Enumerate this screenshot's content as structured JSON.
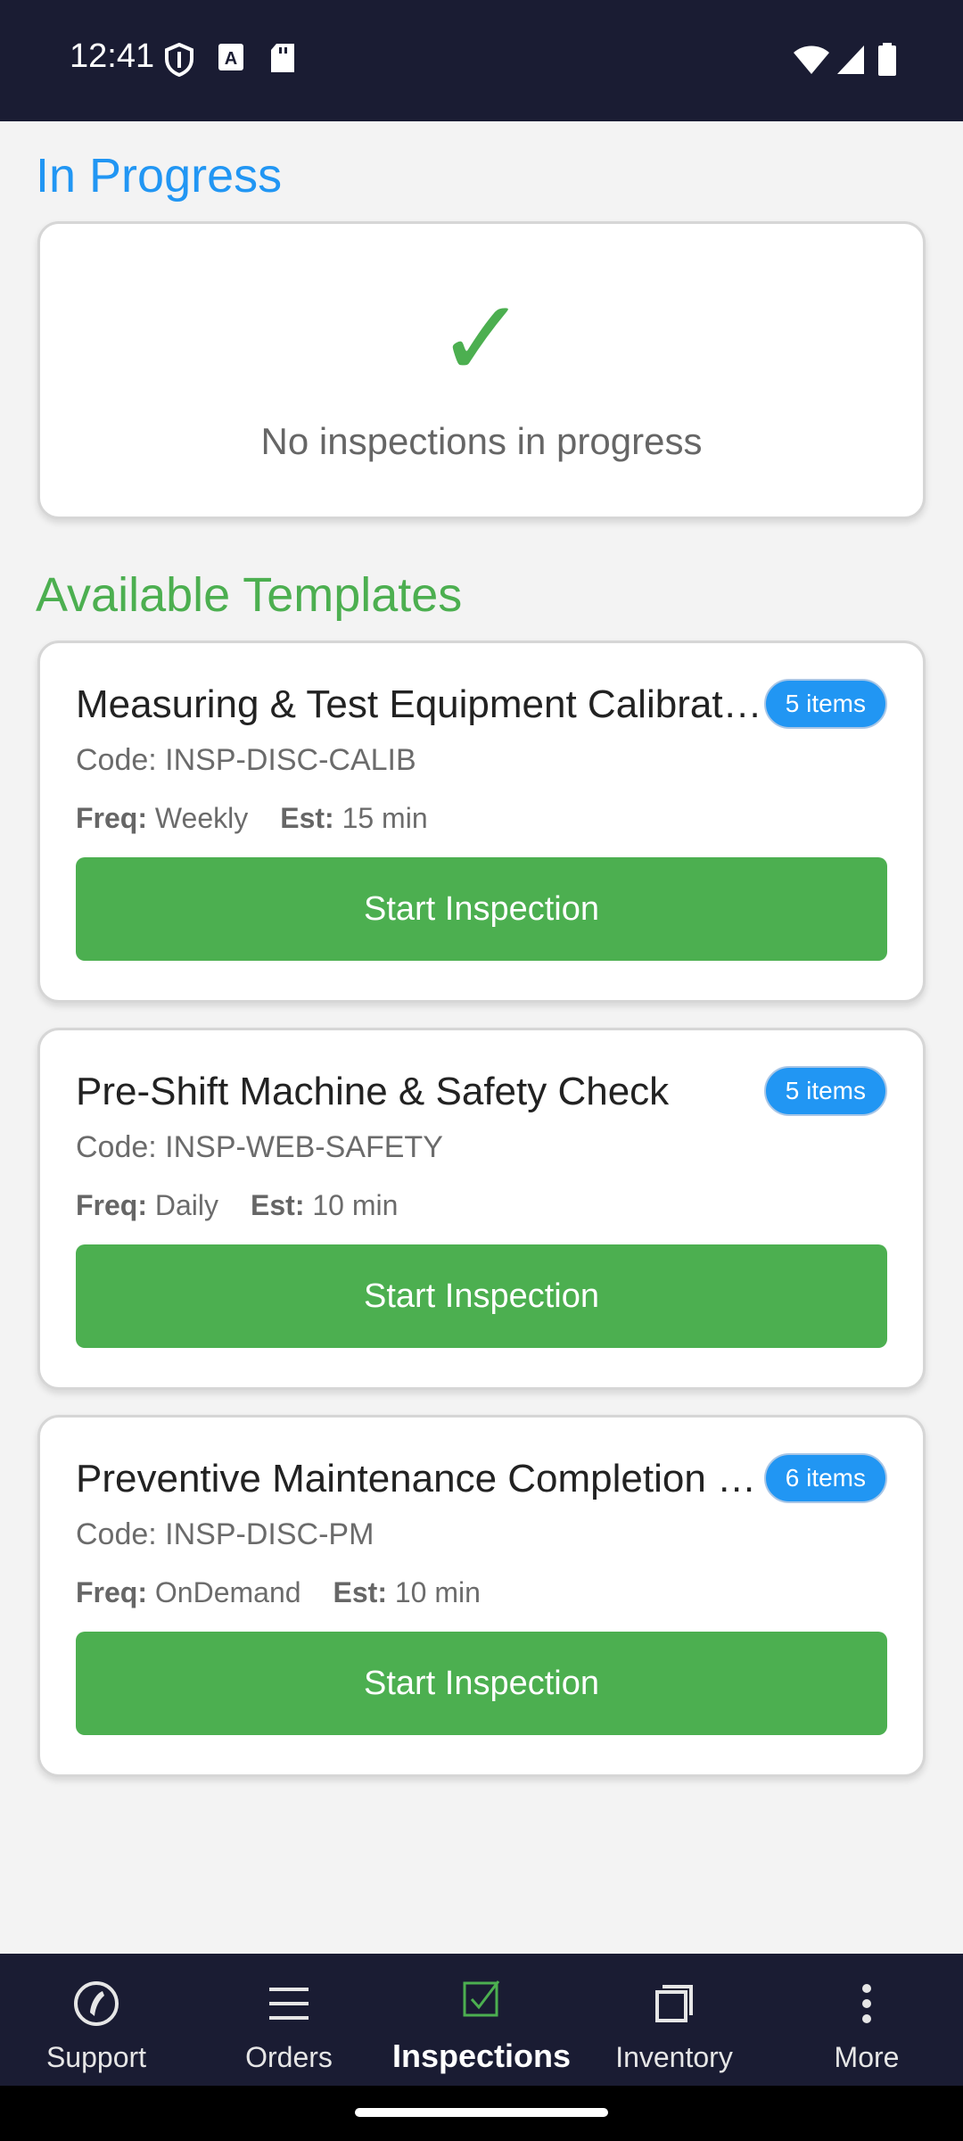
{
  "status_bar": {
    "time": "12:41",
    "icons": [
      "shield-icon",
      "a-notification-icon",
      "sd-card-icon",
      "wifi-icon",
      "signal-icon",
      "battery-icon"
    ]
  },
  "colors": {
    "in_progress_title": "#2196f3",
    "available_title": "#4caf50",
    "button": "#4caf50",
    "badge": "#2196f3",
    "nav_bg": "#1a1c33"
  },
  "in_progress": {
    "title": "In Progress",
    "empty_icon": "✓",
    "empty_text": "No inspections in progress"
  },
  "available": {
    "title": "Available Templates",
    "templates": [
      {
        "name": "Measuring & Test Equipment Calibration",
        "badge": "5 items",
        "code": "Code: INSP-DISC-CALIB",
        "freq_label": "Freq:",
        "freq": "Weekly",
        "est_label": "Est:",
        "est": "15 min",
        "button": "Start Inspection"
      },
      {
        "name": "Pre-Shift Machine & Safety Check",
        "badge": "5 items",
        "code": "Code: INSP-WEB-SAFETY",
        "freq_label": "Freq:",
        "freq": "Daily",
        "est_label": "Est:",
        "est": "10 min",
        "button": "Start Inspection"
      },
      {
        "name": "Preventive Maintenance Completion Check",
        "badge": "6 items",
        "code": "Code: INSP-DISC-PM",
        "freq_label": "Freq:",
        "freq": "OnDemand",
        "est_label": "Est:",
        "est": "10 min",
        "button": "Start Inspection"
      }
    ]
  },
  "bottom_nav": {
    "items": [
      {
        "label": "Support",
        "icon": "phone-icon",
        "active": false
      },
      {
        "label": "Orders",
        "icon": "list-icon",
        "active": false
      },
      {
        "label": "Inspections",
        "icon": "checkbox-icon",
        "active": true
      },
      {
        "label": "Inventory",
        "icon": "box-icon",
        "active": false
      },
      {
        "label": "More",
        "icon": "more-vertical-icon",
        "active": false
      }
    ]
  }
}
